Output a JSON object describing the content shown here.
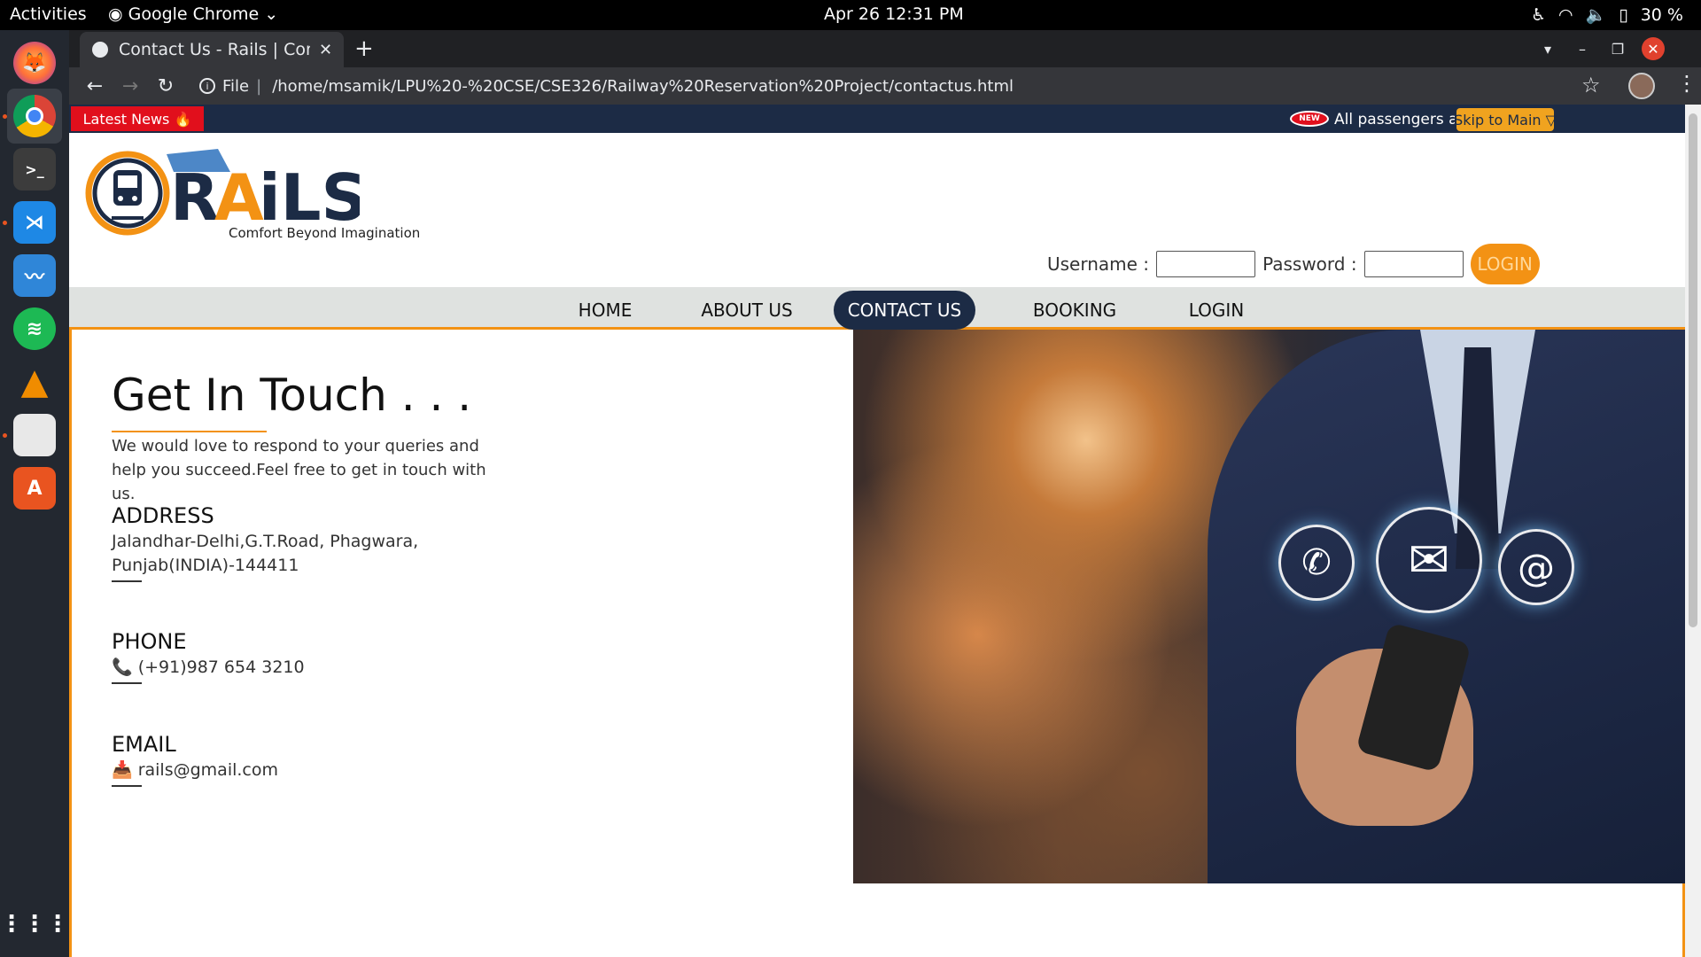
{
  "system": {
    "activities": "Activities",
    "app_menu": "Google Chrome",
    "clock": "Apr 26  12:31 PM",
    "battery": "30 %"
  },
  "dock": {
    "apps": [
      "firefox-icon",
      "chrome-icon",
      "terminal-icon",
      "vscode-icon",
      "system-monitor-icon",
      "spotify-icon",
      "vlc-icon",
      "files-icon",
      "software-center-icon",
      "app-grid-icon"
    ]
  },
  "browser": {
    "tab_title": "Contact Us - Rails | Comfort Beyond Imagination",
    "scheme_label": "File",
    "url": "/home/msamik/LPU%20-%20CSE/CSE326/Railway%20Reservation%20Project/contactus.html"
  },
  "newsbar": {
    "latest_news": "Latest News 🔥",
    "badge": "NEW",
    "ticker": "All passengers are r",
    "skip_main": "Skip to Main ▽"
  },
  "header": {
    "logo_text": "Comfort Beyond Imagination",
    "username_label": "Username :",
    "password_label": "Password :",
    "login_button": "LOGIN"
  },
  "nav": {
    "items": [
      "HOME",
      "ABOUT US",
      "CONTACT US",
      "BOOKING",
      "LOGIN"
    ],
    "active": "CONTACT US"
  },
  "contact": {
    "title": "Get In Touch . . .",
    "subtitle": "We would love to respond to your queries and help you succeed.Feel free to get in touch with us.",
    "address_heading": "ADDRESS",
    "address_line1": "Jalandhar-Delhi,G.T.Road, Phagwara,",
    "address_line2": "Punjab(INDIA)-144411",
    "phone_heading": "PHONE",
    "phone": "(+91)987 654 3210",
    "email_heading": "EMAIL",
    "email": "rails@gmail.com"
  },
  "colors": {
    "accent": "#f39214",
    "navy": "#1c2b45",
    "news_red": "#e10f1c"
  }
}
